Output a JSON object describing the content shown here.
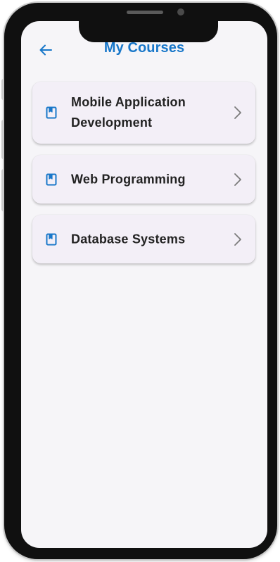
{
  "header": {
    "title": "My Courses",
    "back_icon": "arrow-left-icon"
  },
  "courses": [
    {
      "name": "Mobile Application Development",
      "icon": "book-icon",
      "trailing_icon": "chevron-right-icon"
    },
    {
      "name": "Web Programming",
      "icon": "book-icon",
      "trailing_icon": "chevron-right-icon"
    },
    {
      "name": "Database Systems",
      "icon": "book-icon",
      "trailing_icon": "chevron-right-icon"
    }
  ],
  "colors": {
    "accent": "#1877c9",
    "screen_background": "#f6f5f8",
    "card_background": "#f3eff7",
    "text_primary": "#222222",
    "chevron": "#7a7a7a"
  }
}
